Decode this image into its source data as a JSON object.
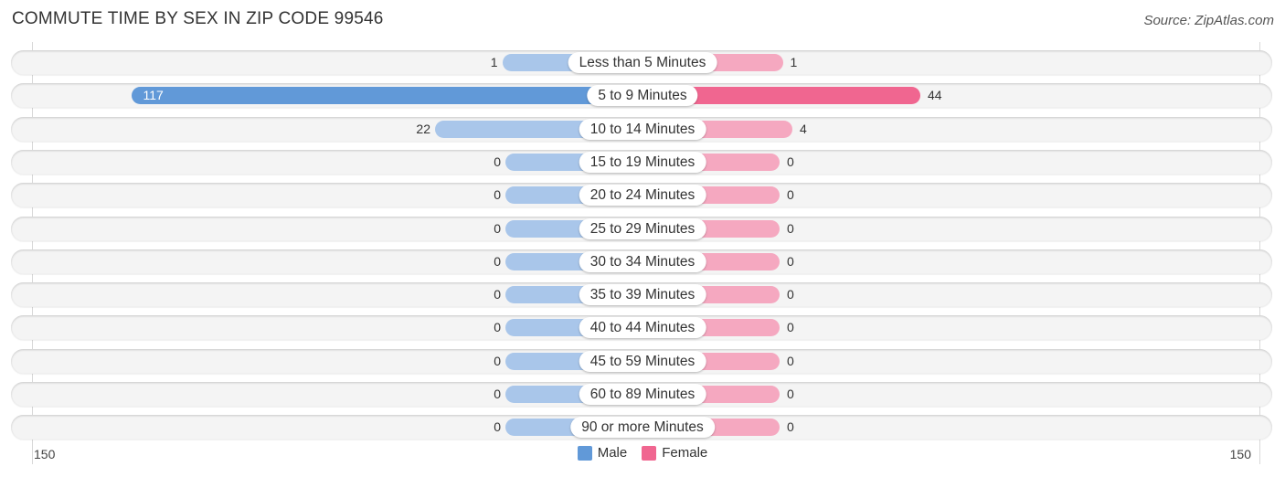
{
  "header": {
    "title": "COMMUTE TIME BY SEX IN ZIP CODE 99546",
    "source": "Source: ZipAtlas.com"
  },
  "colors": {
    "male_strong": "#6199d8",
    "male_light": "#a9c6ea",
    "female_strong": "#f06690",
    "female_light": "#f5a8c0"
  },
  "chart_data": {
    "type": "bar",
    "orientation": "horizontal-diverging",
    "title": "COMMUTE TIME BY SEX IN ZIP CODE 99546",
    "categories": [
      "Less than 5 Minutes",
      "5 to 9 Minutes",
      "10 to 14 Minutes",
      "15 to 19 Minutes",
      "20 to 24 Minutes",
      "25 to 29 Minutes",
      "30 to 34 Minutes",
      "35 to 39 Minutes",
      "40 to 44 Minutes",
      "45 to 59 Minutes",
      "60 to 89 Minutes",
      "90 or more Minutes"
    ],
    "series": [
      {
        "name": "Male",
        "values": [
          1,
          117,
          22,
          0,
          0,
          0,
          0,
          0,
          0,
          0,
          0,
          0
        ]
      },
      {
        "name": "Female",
        "values": [
          1,
          44,
          4,
          0,
          0,
          0,
          0,
          0,
          0,
          0,
          0,
          0
        ]
      }
    ],
    "xlim": [
      -150,
      150
    ],
    "axis_tick_labels": {
      "left": "150",
      "right": "150"
    },
    "legend": {
      "position": "bottom-center",
      "entries": [
        "Male",
        "Female"
      ]
    },
    "grid": false
  }
}
